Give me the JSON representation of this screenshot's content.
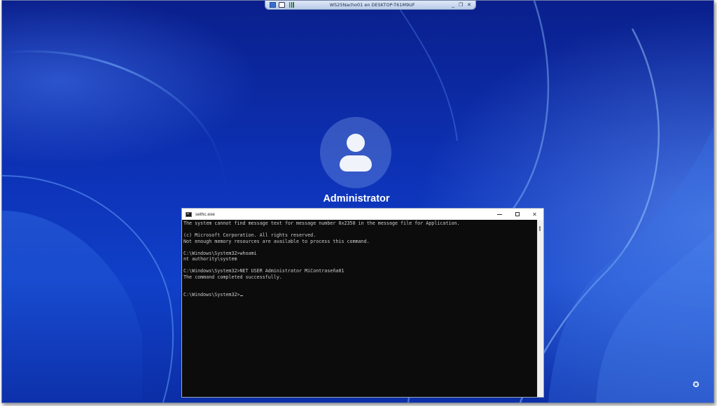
{
  "rdp_bar": {
    "title": "WS25Nacho01 en DESKTOP-T61M9UF",
    "icons": [
      "pin-icon",
      "lock-icon",
      "signal-icon"
    ],
    "minimize_label": "_",
    "restore_label": "❐",
    "close_label": "✕"
  },
  "lock_screen": {
    "username": "Administrator",
    "avatar_icon": "user-avatar-icon"
  },
  "console": {
    "title": "sethc.exe",
    "close_label": "✕",
    "lines": [
      "The system cannot find message text for message number 0x2350 in the message file for Application.",
      "",
      "(c) Microsoft Corporation. All rights reserved.",
      "Not enough memory resources are available to process this command.",
      "",
      "C:\\Windows\\System32>whoami",
      "nt authority\\system",
      "",
      "C:\\Windows\\System32>NET USER Administrator MiContraseña01",
      "The command completed successfully.",
      "",
      "",
      "C:\\Windows\\System32>"
    ]
  },
  "accessibility": {
    "icon": "accessibility-icon",
    "glyph": "✪"
  },
  "colors": {
    "wallpaper_blue": "#0d33b8",
    "console_bg": "#0c0c0c",
    "console_text": "#cccccc"
  }
}
